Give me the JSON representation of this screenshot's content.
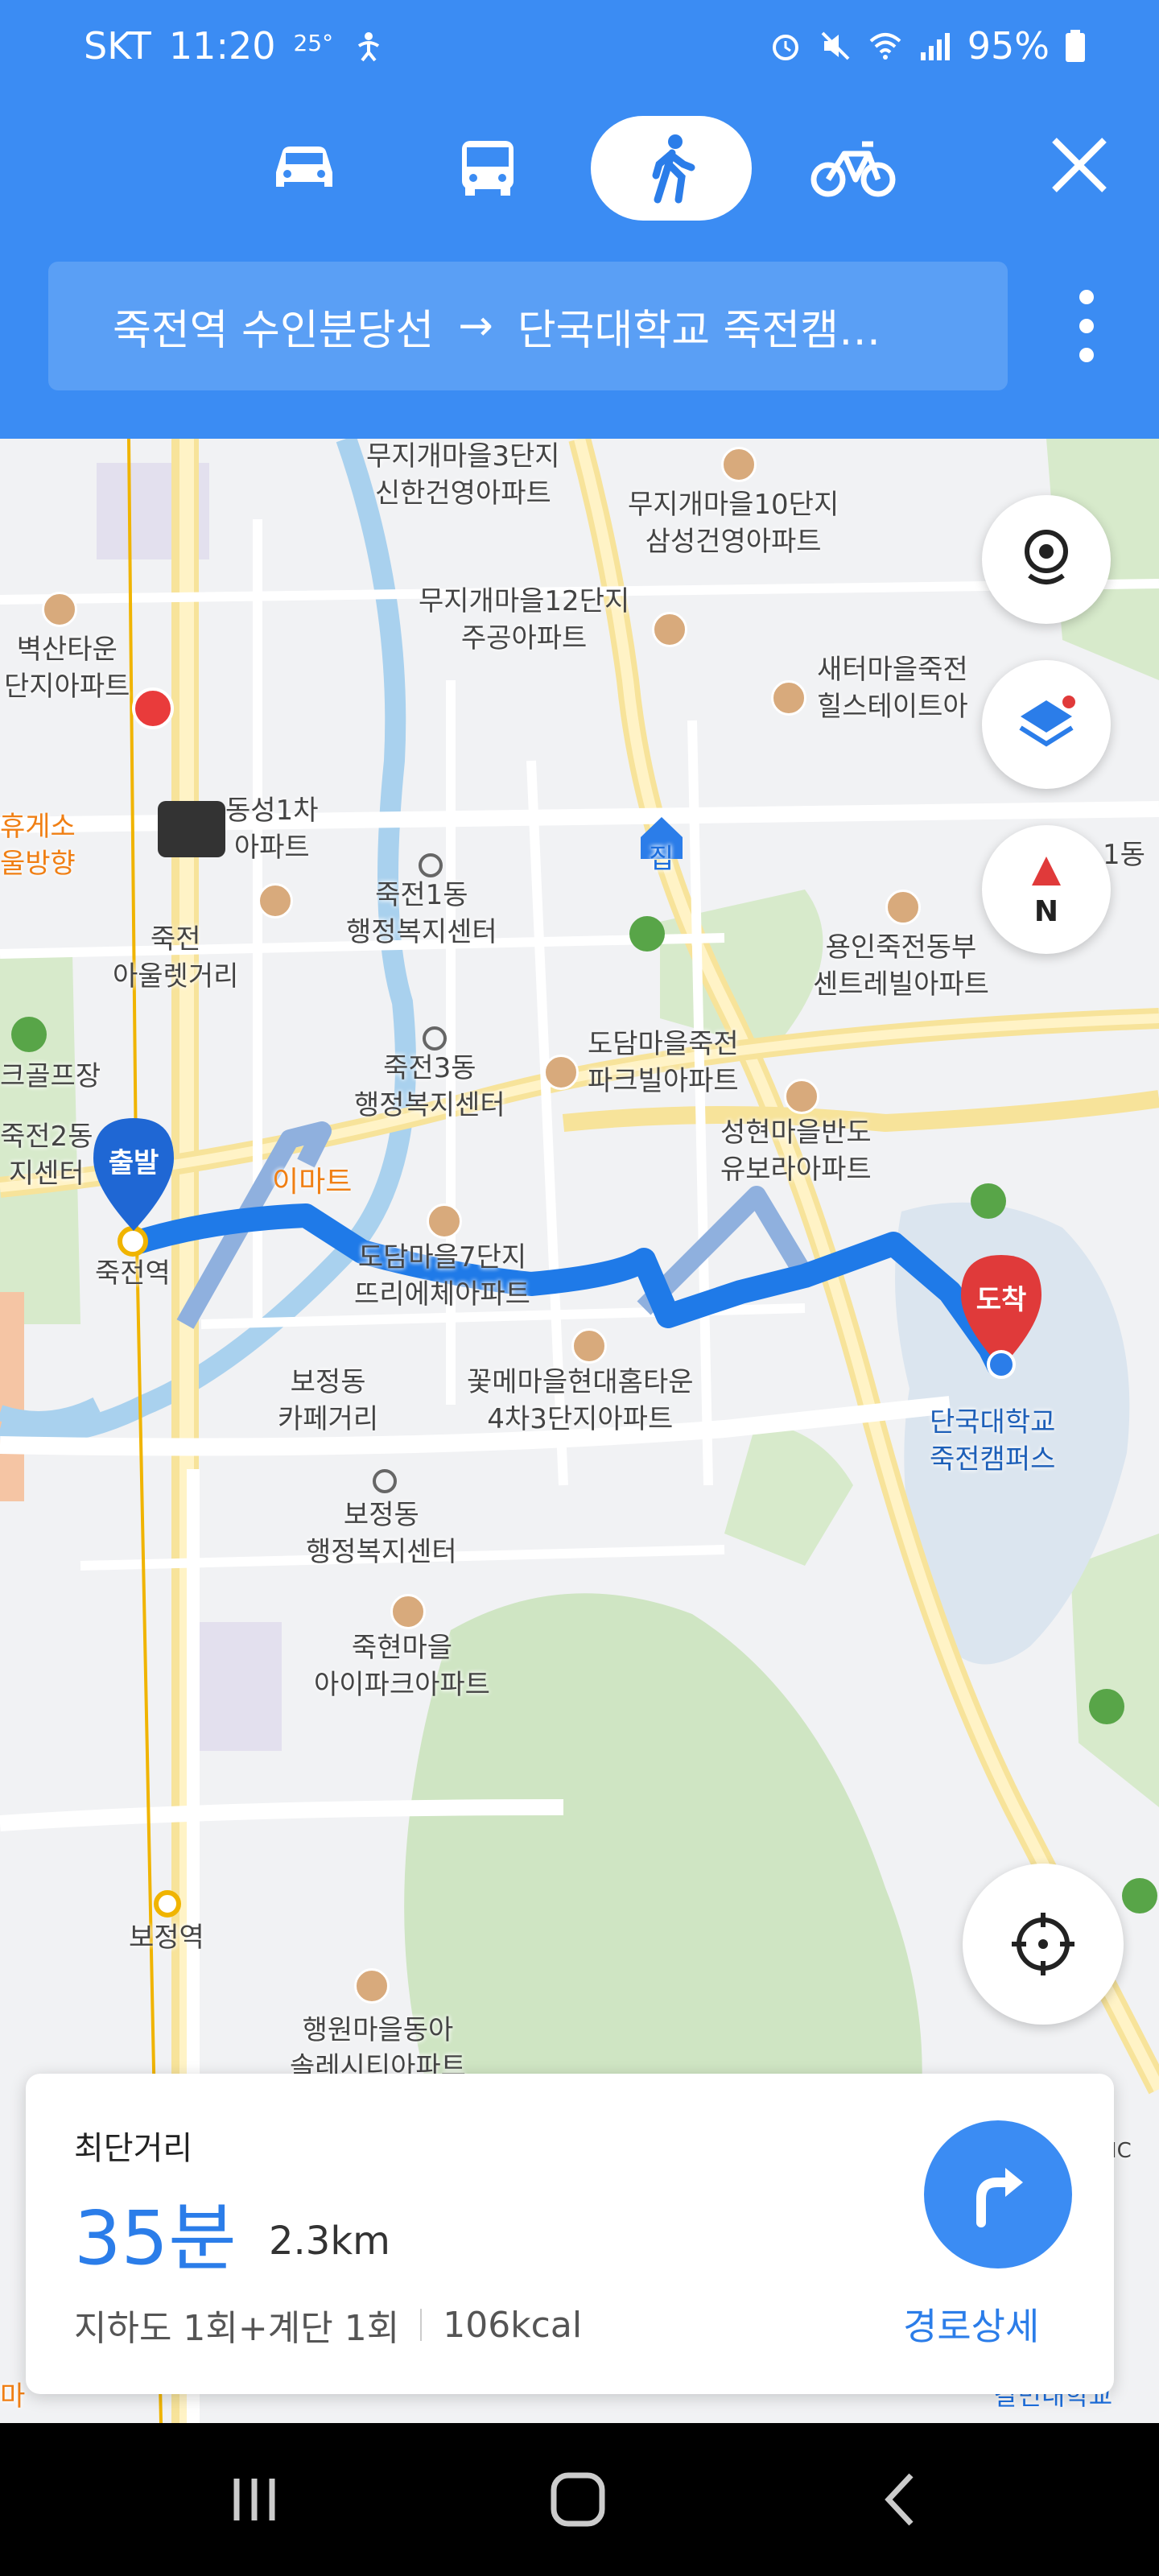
{
  "status_bar": {
    "carrier": "SKT",
    "time": "11:20",
    "temperature": "25°",
    "battery": "95%"
  },
  "transport_modes": [
    {
      "name": "car",
      "icon": "car-icon",
      "active": false
    },
    {
      "name": "bus",
      "icon": "bus-icon",
      "active": false
    },
    {
      "name": "walk",
      "icon": "walk-icon",
      "active": true
    },
    {
      "name": "bike",
      "icon": "bike-icon",
      "active": false
    }
  ],
  "route": {
    "origin": "죽전역 수인분당선",
    "arrow": "→",
    "destination": "단국대학교 죽전캠…"
  },
  "map": {
    "labels": {
      "l1": "무지개마을3단지\n신한건영아파트",
      "l2": "무지개마을10단지\n삼성건영아파트",
      "l3": "무지개마을12단지\n주공아파트",
      "l4": "벽산타운\n단지아파트",
      "l5": "새터마을죽전\n힐스테이트아",
      "l6": "휴게소\n울방향",
      "l7": "동성1차\n아파트",
      "l8": "죽전1동\n행정복지센터",
      "l9": "집",
      "l10": "1동",
      "l11": "죽전\n아울렛거리",
      "l12": "용인죽전동부\n센트레빌아파트",
      "l13": "크골프장",
      "l14": "죽전3동\n행정복지센터",
      "l15": "도담마을죽전\n파크빌아파트",
      "l16": "죽전2동\n지센터",
      "l17": "성현마을반도\n유보라아파트",
      "l18": "이마트",
      "l19": "죽전역",
      "l20": "도담마을7단지\n뜨리에체아파트",
      "l21": "단국대학교\n죽전캠퍼스",
      "l22": "보정동\n카페거리",
      "l23": "꽃메마을현대홈타운\n4차3단지아파트",
      "l24": "보정동\n행정복지센터",
      "l25": "죽현마을\n아이파크아파트",
      "l26": "보정역",
      "l27": "행원마을동아\n솔레시티아파트",
      "l28": "갈민내학교",
      "l29": "마",
      "l30": "IC"
    },
    "start_marker": "출발",
    "end_marker": "도착"
  },
  "route_card": {
    "title": "최단거리",
    "duration": "35분",
    "distance": "2.3km",
    "details": "지하도 1회+계단 1회",
    "calories": "106kcal",
    "detail_button": "경로상세"
  },
  "colors": {
    "header": "#3b8cf3",
    "route": "#1f7ae8",
    "destination": "#e03a3a"
  }
}
